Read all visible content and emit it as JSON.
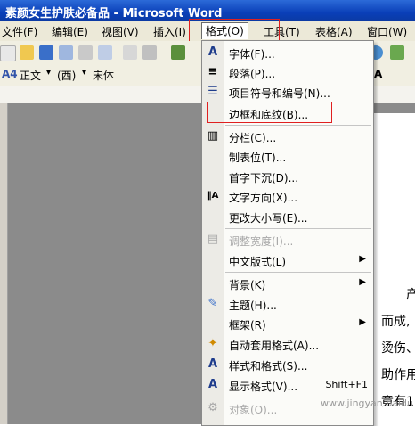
{
  "window": {
    "title": "素颜女生护肤必备品 - Microsoft Word"
  },
  "menubar": {
    "items": [
      {
        "label": "文件(F)"
      },
      {
        "label": "编辑(E)"
      },
      {
        "label": "视图(V)"
      },
      {
        "label": "插入(I)"
      },
      {
        "label": "格式(O)"
      },
      {
        "label": "工具(T)"
      },
      {
        "label": "表格(A)"
      },
      {
        "label": "窗口(W)"
      }
    ]
  },
  "toolbar2": {
    "style_value": "正文",
    "font_hint": "(西)",
    "font_value": "宋体"
  },
  "format_menu": {
    "items": [
      {
        "label": "字体(F)...",
        "icon": "A"
      },
      {
        "label": "段落(P)...",
        "icon": "≡"
      },
      {
        "label": "项目符号和编号(N)...",
        "icon": "☰"
      },
      {
        "label": "边框和底纹(B)...",
        "icon": ""
      },
      {
        "label": "分栏(C)...",
        "icon": "▥"
      },
      {
        "label": "制表位(T)...",
        "icon": ""
      },
      {
        "label": "首字下沉(D)...",
        "icon": ""
      },
      {
        "label": "文字方向(X)...",
        "icon": "‖A"
      },
      {
        "label": "更改大小写(E)...",
        "icon": ""
      },
      {
        "label": "调整宽度(I)...",
        "icon": "▤"
      },
      {
        "label": "中文版式(L)",
        "icon": "",
        "arrow": "▶"
      },
      {
        "label": "背景(K)",
        "icon": "",
        "arrow": "▶"
      },
      {
        "label": "主题(H)...",
        "icon": "✎"
      },
      {
        "label": "框架(R)",
        "icon": "",
        "arrow": "▶"
      },
      {
        "label": "自动套用格式(A)...",
        "icon": "✦"
      },
      {
        "label": "样式和格式(S)...",
        "icon": "A"
      },
      {
        "label": "显示格式(V)...",
        "icon": "A",
        "accel": "Shift+F1"
      },
      {
        "label": "对象(O)...",
        "icon": "⚙"
      }
    ]
  },
  "document": {
    "lines": [
      "产",
      "而成,",
      "烫伤、",
      "助作用",
      "竟有1"
    ]
  },
  "watermark": "www.jingyan.baidu"
}
